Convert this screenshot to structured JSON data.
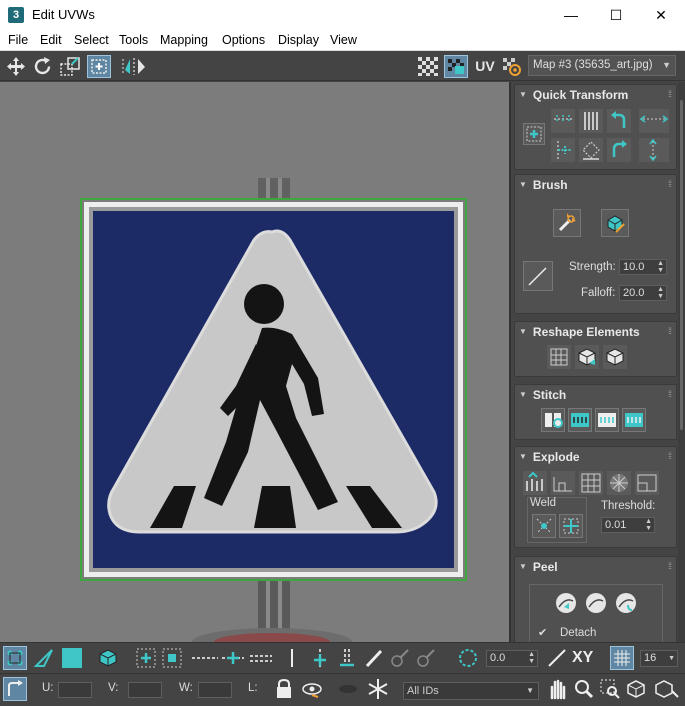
{
  "window": {
    "app_icon_text": "3",
    "title": "Edit UVWs",
    "controls": {
      "minimize": "—",
      "maximize": "☐",
      "close": "✕"
    }
  },
  "menu": [
    "File",
    "Edit",
    "Select",
    "Tools",
    "Mapping",
    "Options",
    "Display",
    "View"
  ],
  "top_toolbar": {
    "uv_label": "UV",
    "map_select": "Map #3 (35635_art.jpg)"
  },
  "rollouts": {
    "quick_transform": "Quick Transform",
    "brush": {
      "title": "Brush",
      "strength_label": "Strength:",
      "strength_value": "10.0",
      "falloff_label": "Falloff:",
      "falloff_value": "20.0"
    },
    "reshape": "Reshape Elements",
    "stitch": "Stitch",
    "explode": {
      "title": "Explode",
      "weld_label": "Weld",
      "threshold_label": "Threshold:",
      "threshold_value": "0.01"
    },
    "peel": {
      "title": "Peel",
      "detach_label": "Detach",
      "detach_checked": true
    }
  },
  "bottom_toolbar": {
    "rotate_value": "0.0",
    "xy_label": "XY",
    "grid_value": "16",
    "u_label": "U:",
    "v_label": "V:",
    "w_label": "W:",
    "l_label": "L:",
    "ids_select": "All IDs"
  },
  "colors": {
    "accent_teal": "#3fc6c6",
    "selection_green": "#3fa53f",
    "sign_blue": "#1c2a66",
    "active_button": "#5f86a3"
  }
}
